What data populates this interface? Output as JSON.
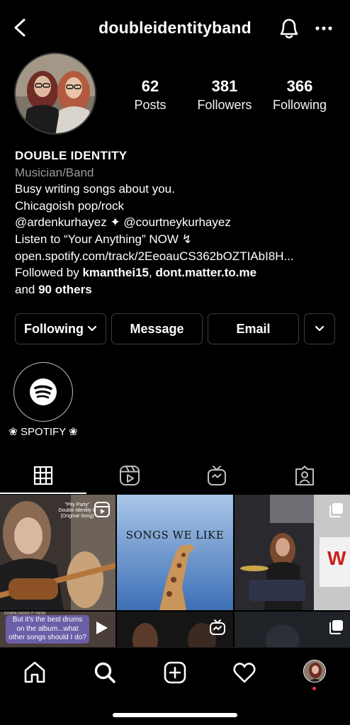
{
  "header": {
    "username": "doubleidentityband"
  },
  "stats": [
    {
      "value": "62",
      "label": "Posts"
    },
    {
      "value": "381",
      "label": "Followers"
    },
    {
      "value": "366",
      "label": "Following"
    }
  ],
  "bio": {
    "name": "DOUBLE IDENTITY",
    "category": "Musician/Band",
    "lines": [
      "Busy writing songs about you.",
      "Chicagoish pop/rock",
      "@ardenkurhayez ✦ @courtneykurhayez",
      "Listen to “Your Anything” NOW ↯",
      "open.spotify.com/track/2EeoauCS362bOZTIAbI8H..."
    ],
    "followed_by_prefix": "Followed by ",
    "followed_user_1": "kmanthei15",
    "followed_sep": ", ",
    "followed_user_2": "dont.matter.to.me",
    "and_prefix": "and ",
    "others": "90 others"
  },
  "buttons": {
    "following": "Following",
    "message": "Message",
    "email": "Email"
  },
  "highlight": {
    "label": "❀ SPOTIFY ❀"
  },
  "tabs": [
    "grid-icon",
    "reels-icon",
    "igtv-icon",
    "tagged-icon"
  ],
  "posts": [
    {
      "overlay_top": "\"Pity Party\"",
      "overlay_mid": "Double Identity B",
      "overlay_bot": "(Original Song)",
      "caption": "But it's the best drums on the album...what other songs should I do?",
      "small": "DOWNLOADED IT FROM"
    },
    {
      "title": "SONGS WE LIKE"
    },
    {
      "sign": "W"
    }
  ],
  "colors": {
    "background": "#000000",
    "border": "#3d3d3d",
    "secondary_text": "#9a9a9a",
    "notification_dot": "#ff3040",
    "caption_bubble": "#6b5fa8"
  }
}
